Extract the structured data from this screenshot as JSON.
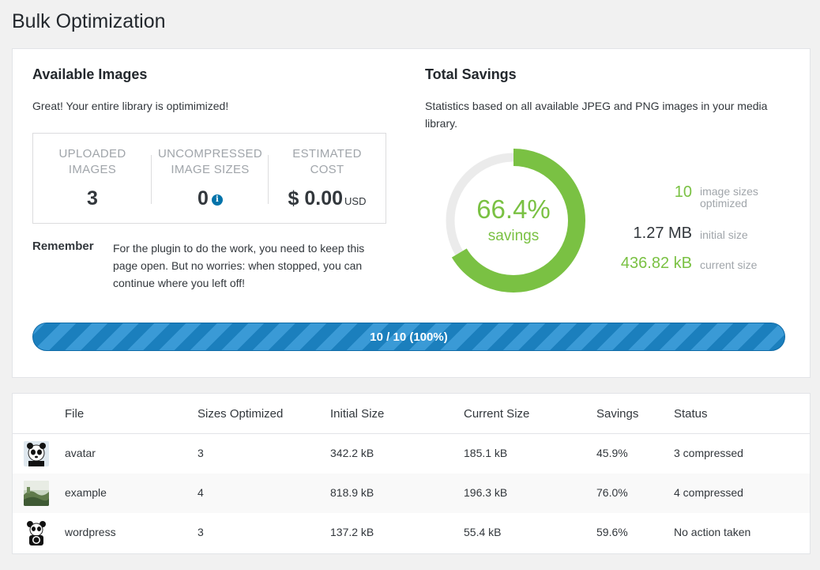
{
  "page": {
    "title": "Bulk Optimization"
  },
  "available": {
    "title": "Available Images",
    "message": "Great! Your entire library is optimimized!",
    "stats": [
      {
        "label_line1": "UPLOADED",
        "label_line2": "IMAGES",
        "value": "3"
      },
      {
        "label_line1": "UNCOMPRESSED",
        "label_line2": "IMAGE SIZES",
        "value": "0"
      },
      {
        "label_line1": "ESTIMATED",
        "label_line2": "COST",
        "value": "$ 0.00",
        "unit": "USD"
      }
    ],
    "info_icon": "info-icon",
    "remember_label": "Remember",
    "remember_text": "For the plugin to do the work, you need to keep this page open. But no worries: when stopped, you can continue where you left off!"
  },
  "savings": {
    "title": "Total Savings",
    "description": "Statistics based on all available JPEG and PNG images in your media library.",
    "percent_text": "66.4%",
    "percent_value": 66.4,
    "percent_label": "savings",
    "rows": [
      {
        "value": "10",
        "label_line1": "image sizes",
        "label_line2": "optimized",
        "color": "#7ac143"
      },
      {
        "value": "1.27 MB",
        "label_line1": "initial size",
        "label_line2": "",
        "color": "#32373c"
      },
      {
        "value": "436.82 kB",
        "label_line1": "current size",
        "label_line2": "",
        "color": "#7ac143"
      }
    ],
    "accent_color": "#7ac143",
    "track_color": "#ebebeb"
  },
  "progress": {
    "text": "10 / 10 (100%)",
    "fraction": 1.0
  },
  "table": {
    "columns": [
      "File",
      "Sizes Optimized",
      "Initial Size",
      "Current Size",
      "Savings",
      "Status"
    ],
    "rows": [
      {
        "thumb": "panda-avatar",
        "file": "avatar",
        "sizes": "3",
        "initial": "342.2 kB",
        "current": "185.1 kB",
        "savings": "45.9%",
        "status": "3 compressed"
      },
      {
        "thumb": "landscape-image",
        "file": "example",
        "sizes": "4",
        "initial": "818.9 kB",
        "current": "196.3 kB",
        "savings": "76.0%",
        "status": "4 compressed"
      },
      {
        "thumb": "panda-wordpress",
        "file": "wordpress",
        "sizes": "3",
        "initial": "137.2 kB",
        "current": "55.4 kB",
        "savings": "59.6%",
        "status": "No action taken"
      }
    ]
  }
}
